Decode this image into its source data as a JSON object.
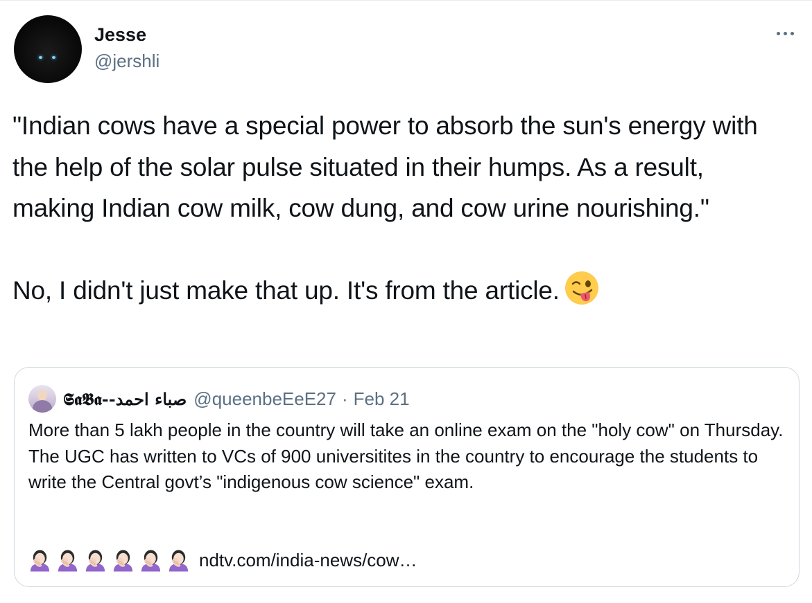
{
  "tweet": {
    "author_name": "Jesse",
    "author_handle": "@jershli",
    "avatar_icon": "black-cat-avatar",
    "more_icon": "more-options-icon",
    "text_paragraph_1": "\"Indian cows have a special power to absorb the sun's energy with the help of the solar pulse situated in their humps. As a result, making Indian cow milk, cow dung, and cow urine nourishing.\"",
    "text_paragraph_2": "No, I didn't just make that up. It's from the article.",
    "emoji": "winking-face-with-tongue"
  },
  "quoted_tweet": {
    "author_name": "𝕾𝖆𝕭𝖆--صباء احمد",
    "author_handle": "@queenbeEeE27",
    "separator": "·",
    "date": "Feb 21",
    "text": "More than 5 lakh people in the country will take an online exam on the \"holy cow\" on Thursday. The UGC has written to VCs of 900 universitites in the country to encourage the students to write the Central govt’s \"indigenous cow science\" exam.",
    "emoji_row": [
      "woman-facepalming",
      "woman-facepalming",
      "woman-facepalming",
      "woman-facepalming",
      "woman-facepalming",
      "woman-facepalming"
    ],
    "link_text": "ndtv.com/india-news/cow…"
  },
  "colors": {
    "text_primary": "#0f1419",
    "text_secondary": "#5b7083",
    "border": "#cfd9de"
  }
}
